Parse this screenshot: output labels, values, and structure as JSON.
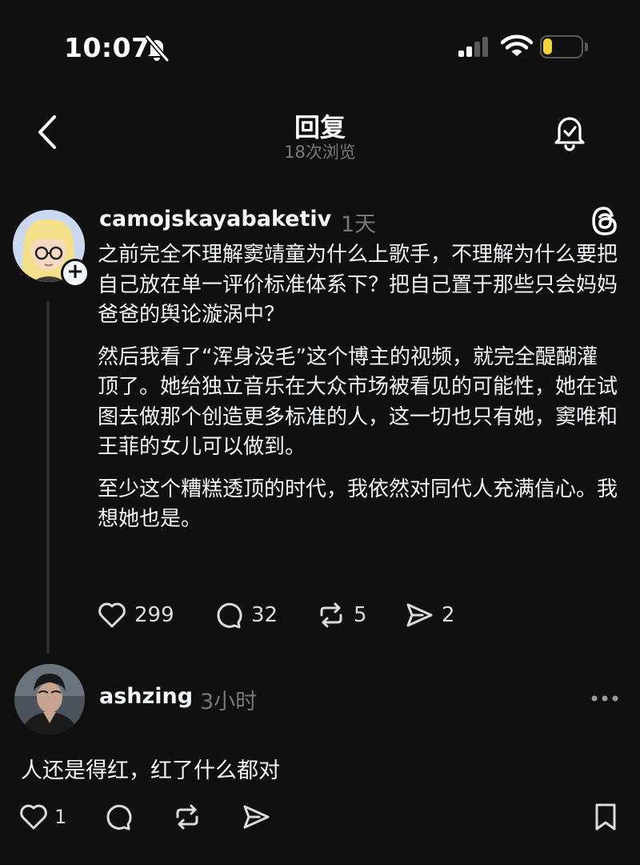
{
  "status_bar": {
    "time": "10:07",
    "battery": "19"
  },
  "header": {
    "title": "回复",
    "subtitle": "18次浏览"
  },
  "post": {
    "username": "camojskayabaketiv",
    "time": "1天",
    "paragraphs": [
      "之前完全不理解窦靖童为什么上歌手，不理解为什么要把自己放在单一评价标准体系下？把自己置于那些只会妈妈爸爸的舆论漩涡中？",
      "然后我看了“浑身没毛”这个博主的视频，就完全醍醐灌顶了。她给独立音乐在大众市场被看见的可能性，她在试图去做那个创造更多标准的人，这一切也只有她，窦唯和王菲的女儿可以做到。",
      "至少这个糟糕透顶的时代，我依然对同代人充满信心。我想她也是。"
    ],
    "likes": "299",
    "comments": "32",
    "reposts": "5",
    "shares": "2"
  },
  "reply": {
    "username": "ashzing",
    "time": "3小时",
    "text": "人还是得红，红了什么都对",
    "likes": "1"
  },
  "colors": {
    "background": "#101010",
    "text": "#f3f5f7",
    "muted": "#777777",
    "battery": "#f2d33a"
  }
}
